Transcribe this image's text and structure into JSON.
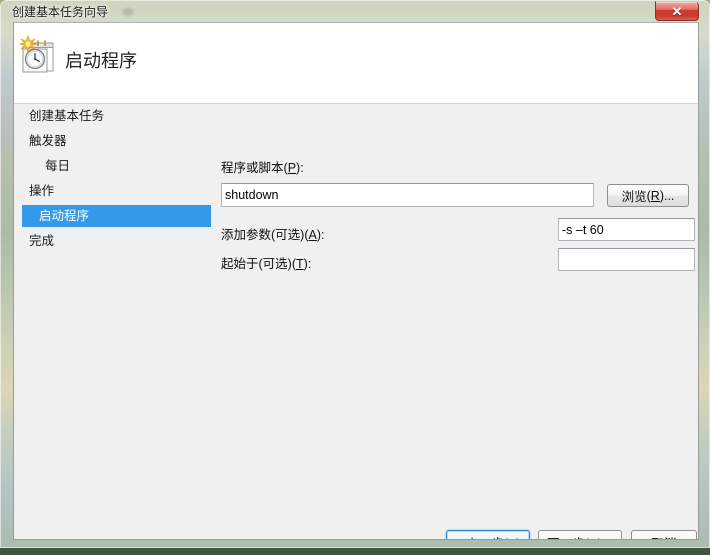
{
  "window": {
    "title": "创建基本任务向导",
    "close_label": "✕",
    "close_icon": "close-icon"
  },
  "header": {
    "title": "启动程序",
    "icon": "task-clock-calendar-icon"
  },
  "sidebar": {
    "items": [
      {
        "label": "创建基本任务",
        "indent": false,
        "selected": false
      },
      {
        "label": "触发器",
        "indent": false,
        "selected": false
      },
      {
        "label": "每日",
        "indent": true,
        "selected": false
      },
      {
        "label": "操作",
        "indent": false,
        "selected": false
      },
      {
        "label": "启动程序",
        "indent": true,
        "selected": true
      },
      {
        "label": "完成",
        "indent": false,
        "selected": false
      }
    ]
  },
  "form": {
    "program_label_text": "程序或脚本",
    "program_label_acc": "P",
    "program_label_suffix": ":",
    "program_value": "shutdown",
    "browse_label_text": "浏览",
    "browse_label_acc": "R",
    "browse_label_suffix": "...",
    "arguments_label_text": "添加参数(可选)",
    "arguments_label_acc": "A",
    "arguments_label_suffix": ":",
    "arguments_value": "-s –t 60",
    "startin_label_text": "起始于(可选)",
    "startin_label_acc": "T",
    "startin_label_suffix": ":",
    "startin_value": ""
  },
  "footer": {
    "back_label": "< 上一步(B)",
    "back_acc": "B",
    "next_label": "下一步(N) >",
    "next_acc": "N",
    "cancel_label": "取消"
  },
  "colors": {
    "selection_blue": "#3399e8",
    "client_bg": "#f0f0f0",
    "header_bg": "#ffffff",
    "close_red": "#cf3f30"
  }
}
